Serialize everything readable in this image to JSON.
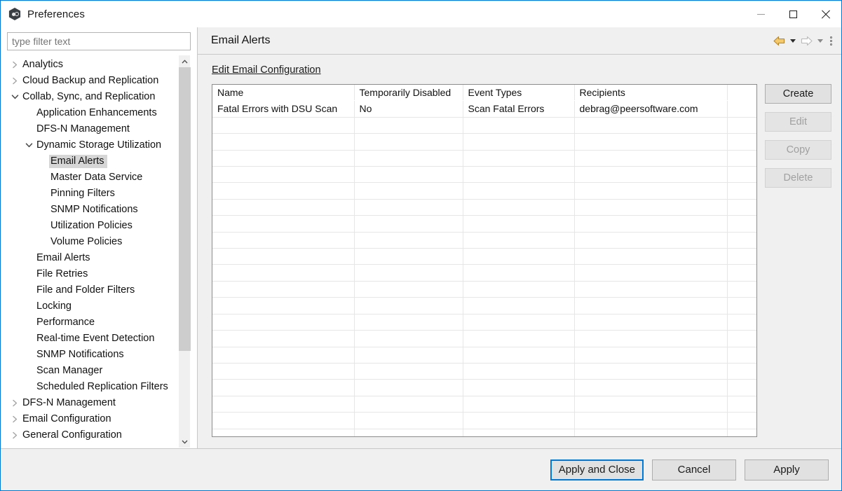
{
  "window": {
    "title": "Preferences",
    "icon": "app-hexagon-icon",
    "controls": {
      "minimize": "minimize-icon",
      "maximize": "maximize-icon",
      "close": "close-icon"
    },
    "border_color": "#0078d7"
  },
  "sidebar": {
    "filter": {
      "value": "",
      "placeholder": "type filter text"
    },
    "items": [
      {
        "label": "Analytics",
        "indent": 0,
        "twisty": "collapsed",
        "selected": false
      },
      {
        "label": "Cloud Backup and Replication",
        "indent": 0,
        "twisty": "collapsed",
        "selected": false
      },
      {
        "label": "Collab, Sync, and Replication",
        "indent": 0,
        "twisty": "expanded",
        "selected": false
      },
      {
        "label": "Application Enhancements",
        "indent": 1,
        "twisty": "none",
        "selected": false
      },
      {
        "label": "DFS-N Management",
        "indent": 1,
        "twisty": "none",
        "selected": false
      },
      {
        "label": "Dynamic Storage Utilization",
        "indent": 1,
        "twisty": "expanded",
        "selected": false
      },
      {
        "label": "Email Alerts",
        "indent": 2,
        "twisty": "none",
        "selected": true
      },
      {
        "label": "Master Data Service",
        "indent": 2,
        "twisty": "none",
        "selected": false
      },
      {
        "label": "Pinning Filters",
        "indent": 2,
        "twisty": "none",
        "selected": false
      },
      {
        "label": "SNMP Notifications",
        "indent": 2,
        "twisty": "none",
        "selected": false
      },
      {
        "label": "Utilization Policies",
        "indent": 2,
        "twisty": "none",
        "selected": false
      },
      {
        "label": "Volume Policies",
        "indent": 2,
        "twisty": "none",
        "selected": false
      },
      {
        "label": "Email Alerts",
        "indent": 1,
        "twisty": "none",
        "selected": false
      },
      {
        "label": "File Retries",
        "indent": 1,
        "twisty": "none",
        "selected": false
      },
      {
        "label": "File and Folder Filters",
        "indent": 1,
        "twisty": "none",
        "selected": false
      },
      {
        "label": "Locking",
        "indent": 1,
        "twisty": "none",
        "selected": false
      },
      {
        "label": "Performance",
        "indent": 1,
        "twisty": "none",
        "selected": false
      },
      {
        "label": "Real-time Event Detection",
        "indent": 1,
        "twisty": "none",
        "selected": false
      },
      {
        "label": "SNMP Notifications",
        "indent": 1,
        "twisty": "none",
        "selected": false
      },
      {
        "label": "Scan Manager",
        "indent": 1,
        "twisty": "none",
        "selected": false
      },
      {
        "label": "Scheduled Replication Filters",
        "indent": 1,
        "twisty": "none",
        "selected": false
      },
      {
        "label": "DFS-N Management",
        "indent": 0,
        "twisty": "collapsed",
        "selected": false
      },
      {
        "label": "Email Configuration",
        "indent": 0,
        "twisty": "collapsed",
        "selected": false
      },
      {
        "label": "General Configuration",
        "indent": 0,
        "twisty": "collapsed",
        "selected": false
      }
    ],
    "scrollbar": {
      "up": "scroll-up-icon",
      "down": "scroll-down-icon"
    }
  },
  "main": {
    "title": "Email Alerts",
    "toolbar": {
      "back": "back-arrow-icon",
      "back_menu": "chevron-down-icon",
      "forward": "forward-arrow-icon",
      "forward_menu": "chevron-down-icon",
      "overflow": "kebab-menu-icon",
      "back_color": "#e5a93a",
      "forward_color": "#b8b8b8"
    },
    "edit_email_configuration_link": "Edit Email Configuration",
    "table": {
      "columns": [
        "Name",
        "Temporarily Disabled",
        "Event Types",
        "Recipients",
        ""
      ],
      "rows": [
        [
          "Fatal Errors with DSU Scan",
          "No",
          "Scan Fatal Errors",
          "debrag@peersoftware.com",
          ""
        ]
      ],
      "empty_row_count": 20
    },
    "buttons": [
      {
        "label": "Create",
        "enabled": true
      },
      {
        "label": "Edit",
        "enabled": false
      },
      {
        "label": "Copy",
        "enabled": false
      },
      {
        "label": "Delete",
        "enabled": false
      }
    ]
  },
  "footer": {
    "apply_and_close": "Apply and Close",
    "cancel": "Cancel",
    "apply": "Apply",
    "focus_color": "#0078d7"
  }
}
